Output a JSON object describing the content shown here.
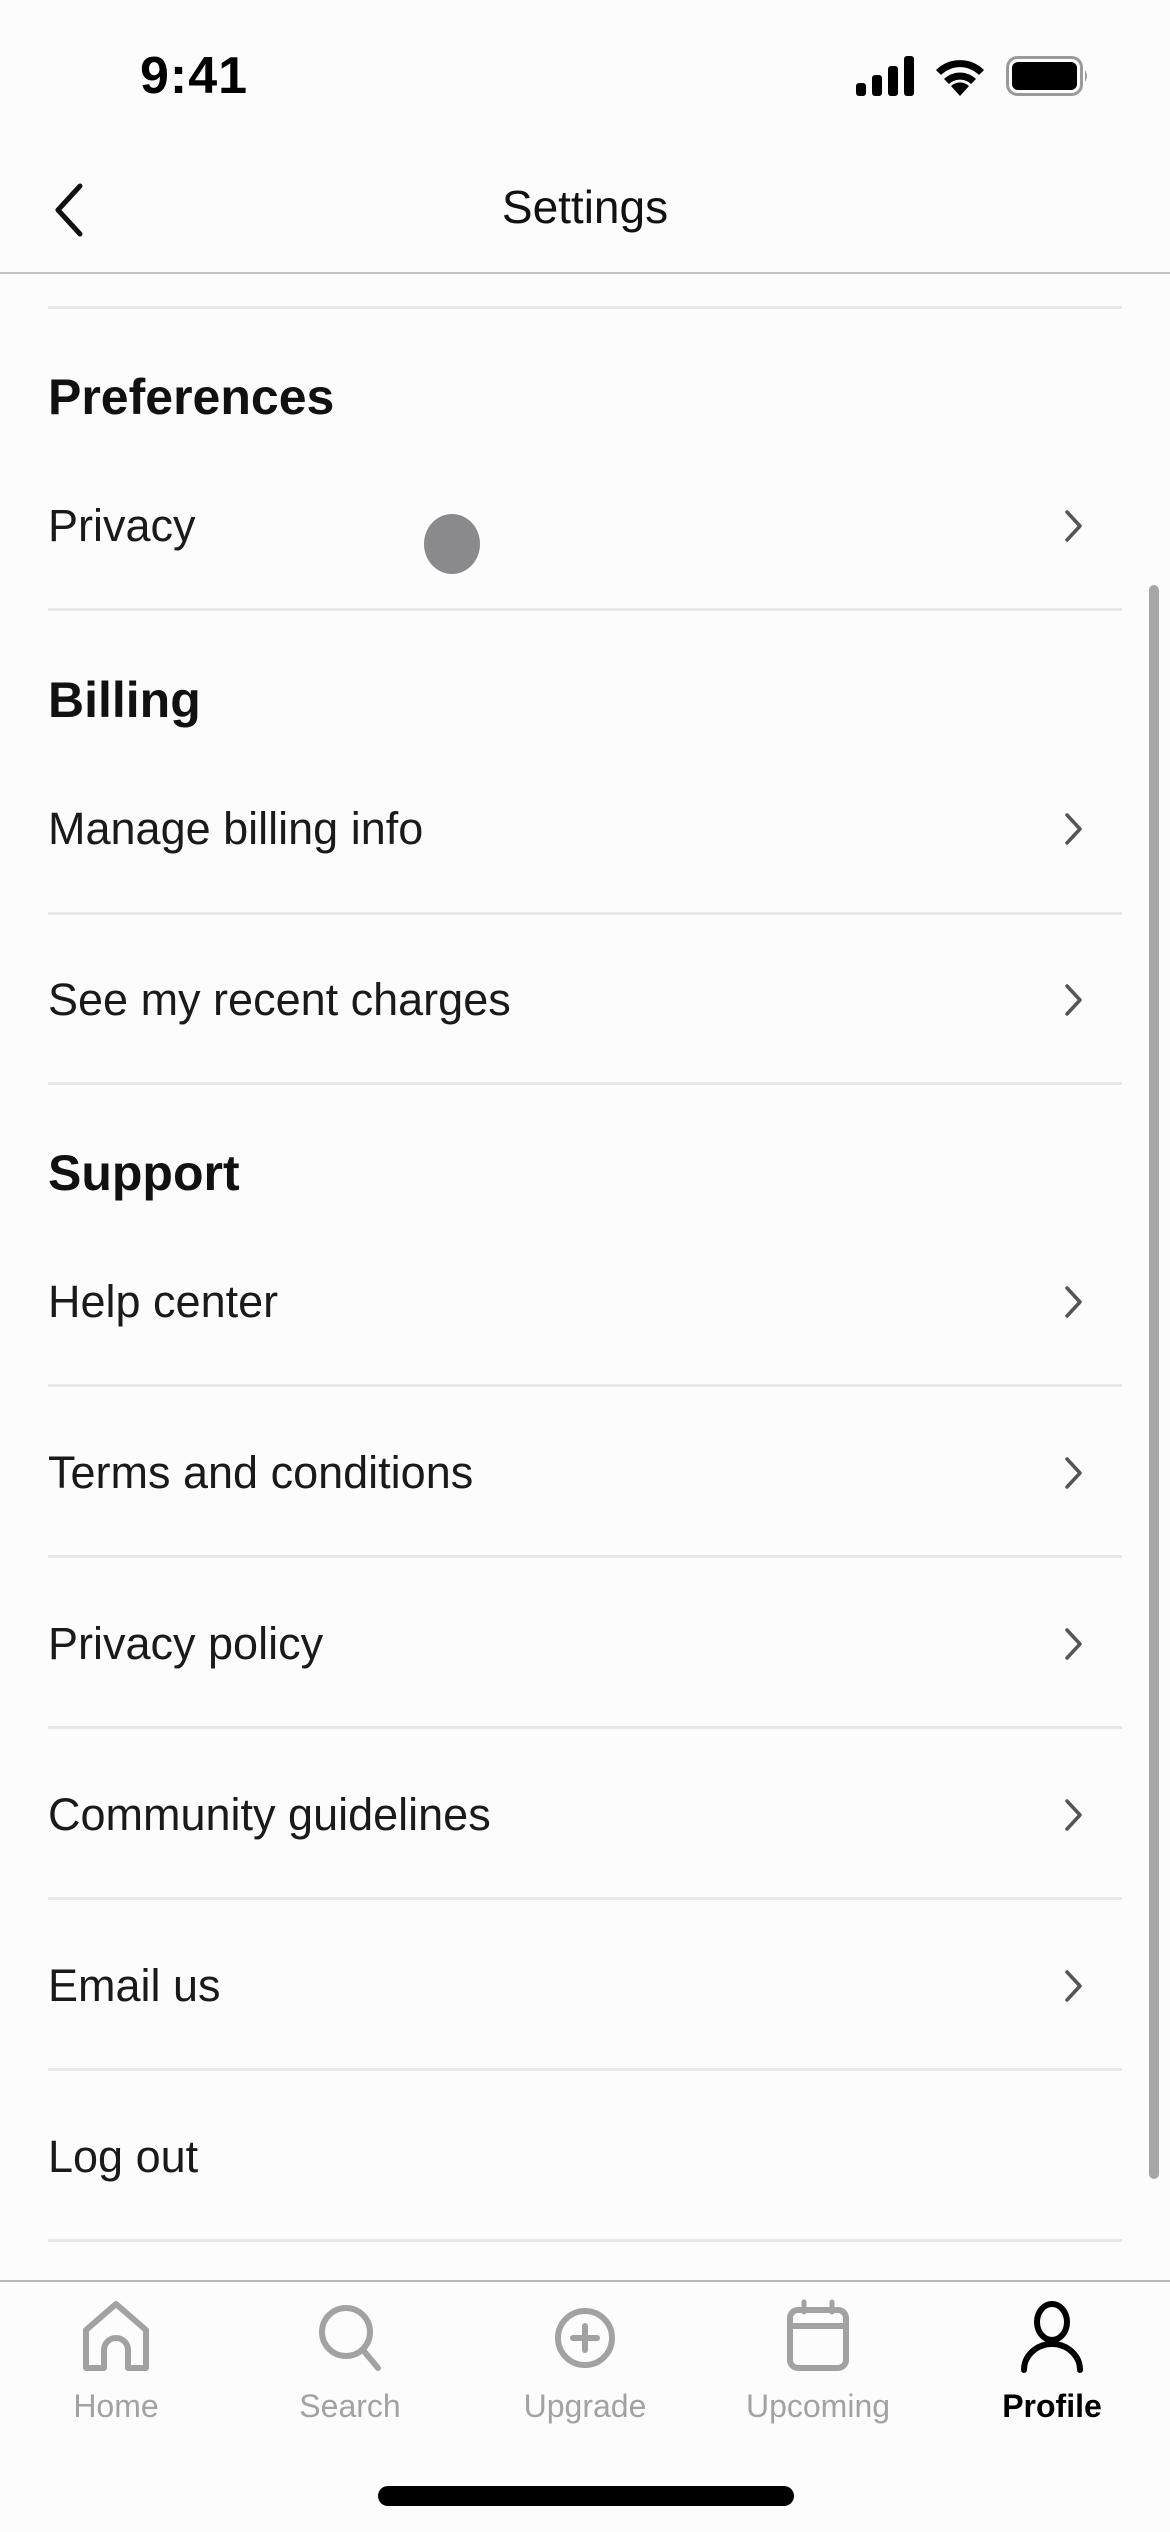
{
  "status_bar": {
    "time": "9:41",
    "icons": [
      "cellular-signal-icon",
      "wifi-icon",
      "battery-icon"
    ]
  },
  "header": {
    "title": "Settings",
    "back_icon": "chevron-left-icon"
  },
  "sections": [
    {
      "title": "Preferences",
      "items": [
        {
          "label": "Privacy",
          "icon": "chevron-right-icon"
        }
      ]
    },
    {
      "title": "Billing",
      "items": [
        {
          "label": "Manage billing info",
          "icon": "chevron-right-icon"
        },
        {
          "label": "See my recent charges",
          "icon": "chevron-right-icon"
        }
      ]
    },
    {
      "title": "Support",
      "items": [
        {
          "label": "Help center",
          "icon": "chevron-right-icon"
        },
        {
          "label": "Terms and conditions",
          "icon": "chevron-right-icon"
        },
        {
          "label": "Privacy policy",
          "icon": "chevron-right-icon"
        },
        {
          "label": "Community guidelines",
          "icon": "chevron-right-icon"
        },
        {
          "label": "Email us",
          "icon": "chevron-right-icon"
        },
        {
          "label": "Log out"
        }
      ]
    }
  ],
  "tab_bar": {
    "tabs": [
      {
        "label": "Home",
        "icon": "home-icon",
        "active": false
      },
      {
        "label": "Search",
        "icon": "search-icon",
        "active": false
      },
      {
        "label": "Upgrade",
        "icon": "plus-circle-icon",
        "active": false
      },
      {
        "label": "Upcoming",
        "icon": "calendar-icon",
        "active": false
      },
      {
        "label": "Profile",
        "icon": "person-icon",
        "active": true
      }
    ]
  },
  "colors": {
    "text_primary": "#111111",
    "tab_inactive": "#a2a2a2",
    "tab_active": "#000000",
    "divider": "#e8e8e8",
    "background": "#fdfcfd"
  }
}
